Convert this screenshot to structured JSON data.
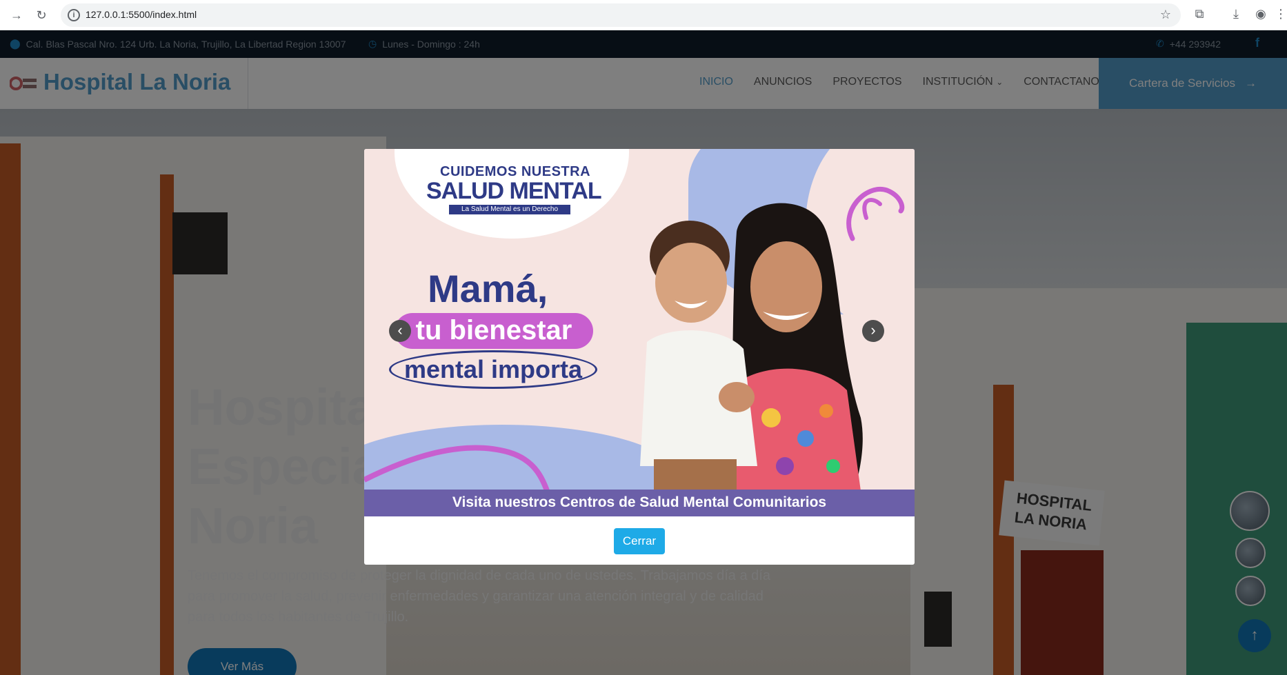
{
  "browser": {
    "url": "127.0.0.1:5500/index.html",
    "icons": [
      "forward-icon",
      "reload-icon",
      "info-icon",
      "star-icon",
      "extensions-icon",
      "download-icon",
      "profile-icon",
      "menu-icon"
    ]
  },
  "topbar": {
    "address": "Cal. Blas Pascal Nro. 124 Urb. La Noria, Trujillo, La Libertad Region 13007",
    "hours": "Lunes - Domingo : 24h",
    "phone": "+44 293942",
    "facebook": "f"
  },
  "header": {
    "brand": "Hospital La Noria",
    "nav": [
      {
        "label": "INICIO"
      },
      {
        "label": "ANUNCIOS"
      },
      {
        "label": "PROYECTOS"
      },
      {
        "label": "INSTITUCIÓN"
      },
      {
        "label": "CONTACTANOS"
      }
    ],
    "cta": "Cartera de Servicios"
  },
  "hero": {
    "title_lines": [
      "Hospital",
      "Especia",
      "Noria"
    ],
    "description": "Tenemos el compromiso de proteger la dignidad de cada uno de ustedes. Trabajamos día a día para promover la salud, prevenir enfermedades y garantizar una atención integral y de calidad para todos los habitantes de Trujillo.",
    "button": "Ver Más",
    "sign_line1": "HOSPITAL",
    "sign_line2": "LA NORIA"
  },
  "modal": {
    "poster": {
      "badge_line1": "CUIDEMOS NUESTRA",
      "badge_line2": "SALUD MENTAL",
      "badge_sub": "La Salud Mental es un Derecho",
      "headline": "Mamá,",
      "pill": "tu bienestar",
      "oval": "mental importa",
      "footer": "Visita nuestros Centros de Salud Mental Comunitarios"
    },
    "prev": "‹",
    "next": "›",
    "close_button": "Cerrar"
  },
  "colors": {
    "brand": "#1177b8",
    "topbar": "#0f1d2a",
    "poster_purple": "#6b5fa8",
    "poster_pink": "#c85fcf",
    "close_button": "#1eaae7"
  }
}
